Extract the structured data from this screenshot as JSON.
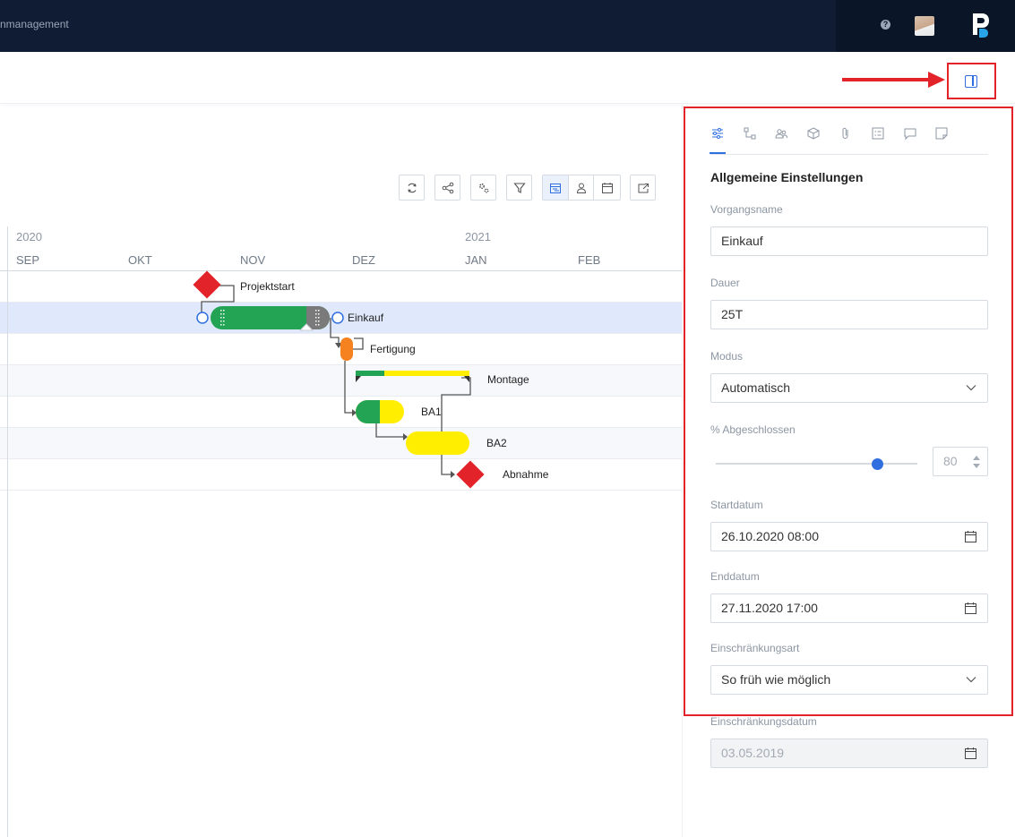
{
  "header": {
    "app_title": "nmanagement",
    "help_icon": "help-icon",
    "logo_letter": "P"
  },
  "toolbar": {
    "buttons": [
      "refresh-icon",
      "share-icon",
      "settings-icon",
      "filter-icon",
      "calendar-view-icon",
      "resource-icon",
      "calendar-icon",
      "export-icon"
    ]
  },
  "timescale": {
    "years": [
      "2020",
      "2021"
    ],
    "months": [
      "SEP",
      "OKT",
      "NOV",
      "DEZ",
      "JAN",
      "FEB"
    ]
  },
  "tasks": [
    {
      "name": "Projektstart",
      "type": "milestone"
    },
    {
      "name": "Einkauf",
      "type": "task",
      "progress": 0.8
    },
    {
      "name": "Fertigung",
      "type": "task"
    },
    {
      "name": "Montage",
      "type": "summary"
    },
    {
      "name": "BA1",
      "type": "task",
      "progress": 0.5
    },
    {
      "name": "BA2",
      "type": "task",
      "progress": 0
    },
    {
      "name": "Abnahme",
      "type": "milestone"
    }
  ],
  "colors": {
    "done": "#23a455",
    "open": "#ffee00",
    "milestone": "#e3232a",
    "orange": "#f5821f",
    "accent": "#2f6fe0",
    "highlight_frame": "#e3232a"
  },
  "panel": {
    "tabs": [
      "settings-sliders-icon",
      "dependencies-icon",
      "resources-icon",
      "cube-icon",
      "attachment-icon",
      "checklist-icon",
      "comment-icon",
      "note-icon"
    ],
    "section_title": "Allgemeine Einstellungen",
    "fields": {
      "vorgangsname": {
        "label": "Vorgangsname",
        "value": "Einkauf"
      },
      "dauer": {
        "label": "Dauer",
        "value": "25T"
      },
      "modus": {
        "label": "Modus",
        "value": "Automatisch"
      },
      "abgeschlossen": {
        "label": "% Abgeschlossen",
        "value": "80"
      },
      "startdatum": {
        "label": "Startdatum",
        "value": "26.10.2020 08:00"
      },
      "enddatum": {
        "label": "Enddatum",
        "value": "27.11.2020 17:00"
      },
      "einschraenkungsart": {
        "label": "Einschränkungsart",
        "value": "So früh wie möglich"
      },
      "einschraenkungsdatum": {
        "label": "Einschränkungsdatum",
        "value": "03.05.2019"
      }
    }
  }
}
